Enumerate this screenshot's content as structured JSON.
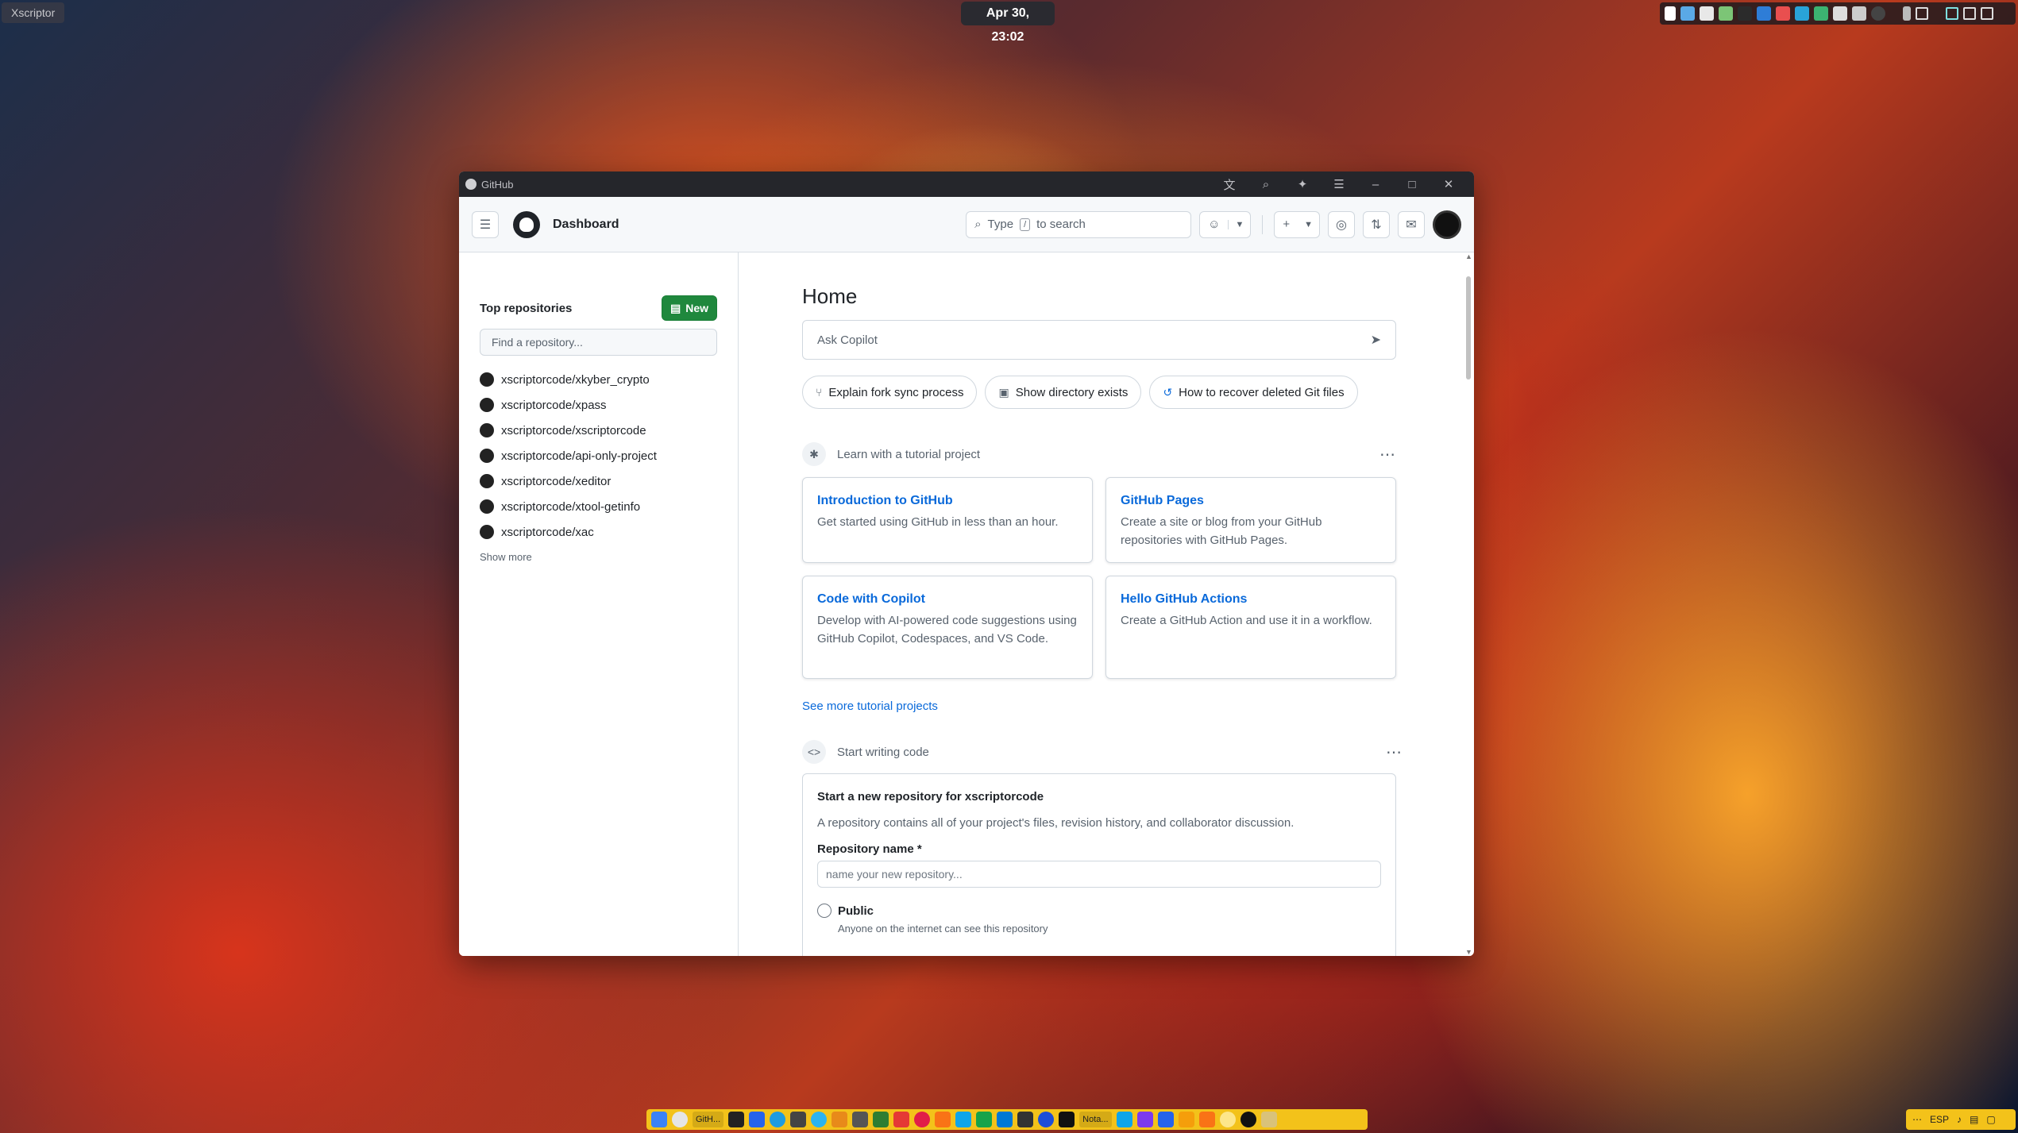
{
  "desktop": {
    "app_tag": "Xscriptor",
    "clock": "Apr 30, 23:02",
    "tray_colors": [
      "#ffffff",
      "#5aa9e6",
      "#e8e8e8",
      "#7cc576",
      "#2ecc71",
      "#e94f8a",
      "#29a3d8",
      "#f39c12",
      "#1abc9c",
      "#dddddd",
      "#888888"
    ],
    "dock_labels": [
      "GitH...",
      "Nota..."
    ],
    "locale": "ESP"
  },
  "window": {
    "title": "GitHub",
    "titlebar_icons": [
      "translate-icon",
      "zoom-icon",
      "extensions-icon",
      "menu-icon",
      "minimize-icon",
      "maximize-icon",
      "close-icon"
    ]
  },
  "header": {
    "title": "Dashboard",
    "search_prefix": "Type",
    "search_key": "/",
    "search_suffix": "to search"
  },
  "sidebar": {
    "heading": "Top repositories",
    "new_label": "New",
    "find_placeholder": "Find a repository...",
    "repos": [
      "xscriptorcode/xkyber_crypto",
      "xscriptorcode/xpass",
      "xscriptorcode/xscriptorcode",
      "xscriptorcode/api-only-project",
      "xscriptorcode/xeditor",
      "xscriptorcode/xtool-getinfo",
      "xscriptorcode/xac"
    ],
    "show_more": "Show more"
  },
  "main": {
    "title": "Home",
    "copilot_placeholder": "Ask Copilot",
    "chips": [
      "Explain fork sync process",
      "Show directory exists",
      "How to recover deleted Git files"
    ],
    "tutorial_section": "Learn with a tutorial project",
    "cards": [
      {
        "title": "Introduction to GitHub",
        "desc": "Get started using GitHub in less than an hour."
      },
      {
        "title": "GitHub Pages",
        "desc": "Create a site or blog from your GitHub repositories with GitHub Pages."
      },
      {
        "title": "Code with Copilot",
        "desc": "Develop with AI-powered code suggestions using GitHub Copilot, Codespaces, and VS Code."
      },
      {
        "title": "Hello GitHub Actions",
        "desc": "Create a GitHub Action and use it in a workflow."
      }
    ],
    "see_more": "See more tutorial projects",
    "code_section": "Start writing code",
    "new_repo": {
      "title": "Start a new repository for xscriptorcode",
      "desc": "A repository contains all of your project's files, revision history, and collaborator discussion.",
      "name_label": "Repository name *",
      "name_placeholder": "name your new repository...",
      "public_label": "Public",
      "public_desc": "Anyone on the internet can see this repository"
    }
  },
  "colors": {
    "accent_green": "#1f883d",
    "link_blue": "#0969da",
    "dock_yellow": "#f3c21a"
  }
}
